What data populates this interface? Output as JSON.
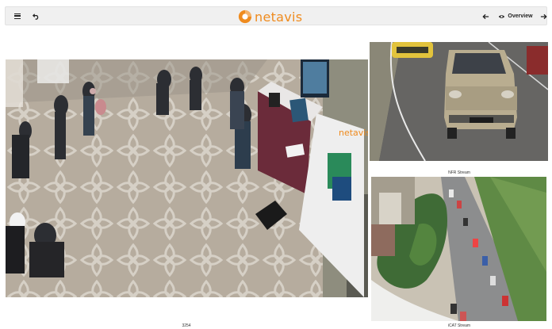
{
  "header": {
    "menu_label": "menu",
    "logo_text": "netavis",
    "overview_label": "Overview"
  },
  "booth": {
    "sign_text": "netavis"
  },
  "cameras": [
    {
      "caption": "3254"
    },
    {
      "caption": "NFR Stream"
    },
    {
      "caption": "iCAT Stream"
    }
  ],
  "icons": [
    "menu-icon",
    "undo-icon",
    "logo-icon",
    "arrow-left-icon",
    "eye-icon",
    "arrow-right-icon"
  ]
}
